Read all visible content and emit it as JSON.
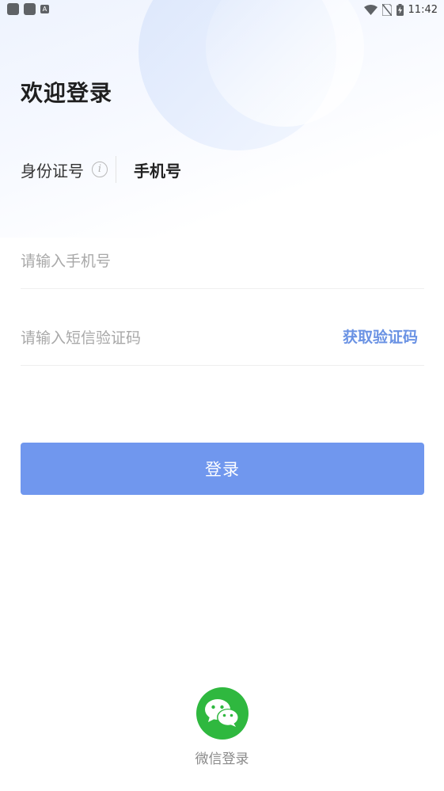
{
  "status_bar": {
    "time": "11:42",
    "left_icons": [
      "app-icon",
      "app-icon",
      "a-icon"
    ],
    "right_icons": [
      "wifi-icon",
      "no-sim-icon",
      "battery-charging-icon"
    ]
  },
  "page": {
    "title": "欢迎登录"
  },
  "tabs": {
    "id_label": "身份证号",
    "phone_label": "手机号",
    "info_icon": "i"
  },
  "form": {
    "phone_placeholder": "请输入手机号",
    "phone_value": "",
    "code_placeholder": "请输入短信验证码",
    "code_value": "",
    "get_code_label": "获取验证码"
  },
  "actions": {
    "login_label": "登录"
  },
  "third_party": {
    "wechat_label": "微信登录",
    "icon": "wechat-icon"
  },
  "colors": {
    "accent": "#7097ee",
    "link": "#6b93e4",
    "wechat": "#2fb83f"
  }
}
